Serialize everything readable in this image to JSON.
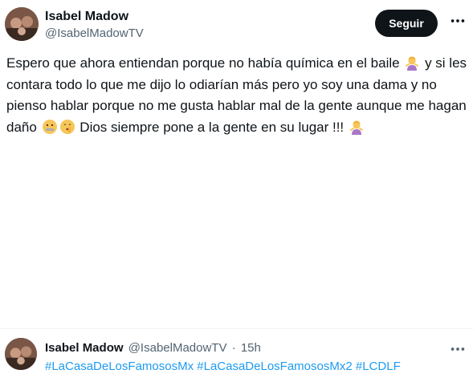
{
  "tweet": {
    "author_name": "Isabel Madow",
    "author_handle": "@IsabelMadowTV",
    "follow_label": "Seguir",
    "text_segments": [
      "Espero que ahora entiendan porque no había química en el baile",
      "y si les contara todo lo que me dijo lo odiarían más pero yo soy una dama y no pienso hablar porque no me gusta hablar mal de la gente aunque me hagan daño",
      "Dios siempre pone a la gente en su lugar !!!"
    ]
  },
  "reply": {
    "author_name": "Isabel Madow",
    "author_handle": "@IsabelMadowTV",
    "separator": "·",
    "time": "15h",
    "hashtags": [
      "#LaCasaDeLosFamososMx",
      "#LaCasaDeLosFamososMx2",
      "#LCDLF"
    ]
  },
  "icons": {
    "more": "more-horizontal-icon",
    "emoji_1": "woman-shrugging-emoji",
    "emoji_2": "zipper-mouth-face-emoji",
    "emoji_3": "shushing-face-emoji",
    "emoji_4": "woman-shrugging-emoji"
  },
  "colors": {
    "text": "#0f1419",
    "secondary": "#536471",
    "link": "#1d9bf0",
    "button_bg": "#0f1419",
    "button_text": "#ffffff"
  }
}
